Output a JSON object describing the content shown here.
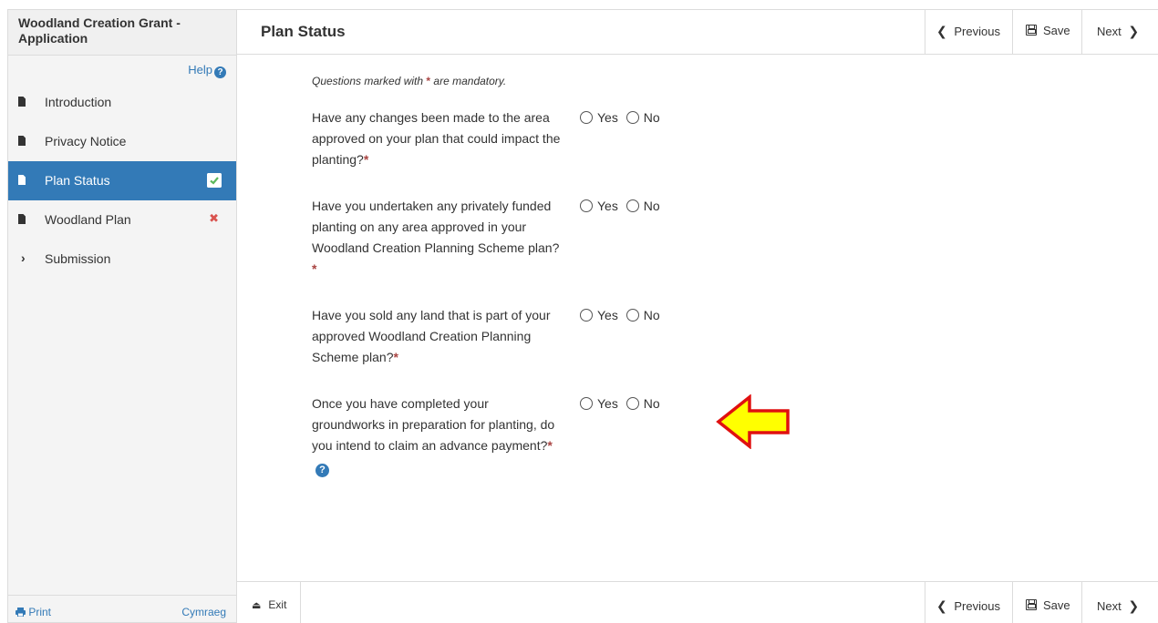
{
  "app": {
    "title": "Woodland Creation Grant - Application"
  },
  "help": {
    "label": "Help"
  },
  "sidebar": {
    "items": [
      {
        "label": "Introduction",
        "status": "none"
      },
      {
        "label": "Privacy Notice",
        "status": "none"
      },
      {
        "label": "Plan Status",
        "status": "complete",
        "active": true
      },
      {
        "label": "Woodland Plan",
        "status": "error"
      },
      {
        "label": "Submission",
        "status": "expandable"
      }
    ],
    "footer": {
      "print": "Print",
      "language": "Cymraeg"
    }
  },
  "header": {
    "title": "Plan Status",
    "previous": "Previous",
    "save": "Save",
    "next": "Next"
  },
  "main": {
    "mandatory_note": "Questions marked with",
    "mandatory_star": "*",
    "mandatory_note_end": "are mandatory.",
    "questions": [
      {
        "text": "Have any changes been made to the area approved on your plan that could impact the planting?",
        "star": "*",
        "opt_yes": "Yes",
        "opt_no": "No"
      },
      {
        "text": "Have you undertaken any privately funded planting on any area approved in your Woodland Creation Planning Scheme plan?",
        "star": "*",
        "opt_yes": "Yes",
        "opt_no": "No"
      },
      {
        "text": "Have you sold any land that is part of your approved Woodland Creation Planning Scheme plan?",
        "star": "*",
        "opt_yes": "Yes",
        "opt_no": "No"
      },
      {
        "text": "Once you have completed your groundworks in preparation for planting, do you intend to claim an advance payment?",
        "star": "*",
        "opt_yes": "Yes",
        "opt_no": "No"
      }
    ]
  },
  "footer": {
    "exit": "Exit",
    "previous": "Previous",
    "save": "Save",
    "next": "Next"
  },
  "colors": {
    "accent": "#337ab7",
    "arrow_fill": "#ffff00",
    "arrow_stroke": "#e01010",
    "error": "#d9534f"
  }
}
